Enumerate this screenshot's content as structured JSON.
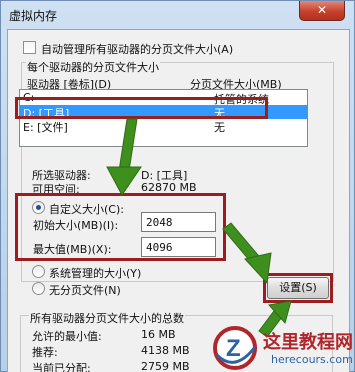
{
  "window": {
    "title": "虚拟内存",
    "close_glyph": "✕"
  },
  "auto_manage": {
    "label": "自动管理所有驱动器的分页文件大小(A)",
    "checked": false
  },
  "per_drive": {
    "group_label": "每个驱动器的分页文件大小",
    "col_drive": "驱动器 [卷标](D)",
    "col_size": "分页文件大小(MB)",
    "rows": [
      {
        "drive": "C:",
        "size": "托管的系统",
        "selected": false
      },
      {
        "drive": "D:  [工具]",
        "size": "无",
        "selected": true
      },
      {
        "drive": "E:  [文件]",
        "size": "无",
        "selected": false
      }
    ]
  },
  "selected_drive": {
    "label": "所选驱动器:",
    "value": "D:  [工具]",
    "free_label": "可用空间:",
    "free_value": "62870 MB"
  },
  "custom_size": {
    "label": "自定义大小(C):",
    "selected": true,
    "initial_label": "初始大小(MB)(I):",
    "initial_value": "2048",
    "max_label": "最大值(MB)(X):",
    "max_value": "4096"
  },
  "system_managed": {
    "label": "系统管理的大小(Y)",
    "selected": false
  },
  "no_paging": {
    "label": "无分页文件(N)",
    "selected": false
  },
  "set_button": {
    "label": "设置(S)"
  },
  "totals": {
    "group_label": "所有驱动器分页文件大小的总数",
    "min_label": "允许的最小值:",
    "min_value": "16 MB",
    "rec_label": "推荐:",
    "rec_value": "4138 MB",
    "cur_label": "当前已分配:",
    "cur_value": "2759 MB"
  },
  "watermark": {
    "logo_letter": "Z",
    "site_name": "这里教程网",
    "site_url": "herecours.com"
  },
  "colors": {
    "annotation_red": "#9b1d1d",
    "annotation_green": "#3e8f1e",
    "selection_blue": "#3399ff"
  }
}
